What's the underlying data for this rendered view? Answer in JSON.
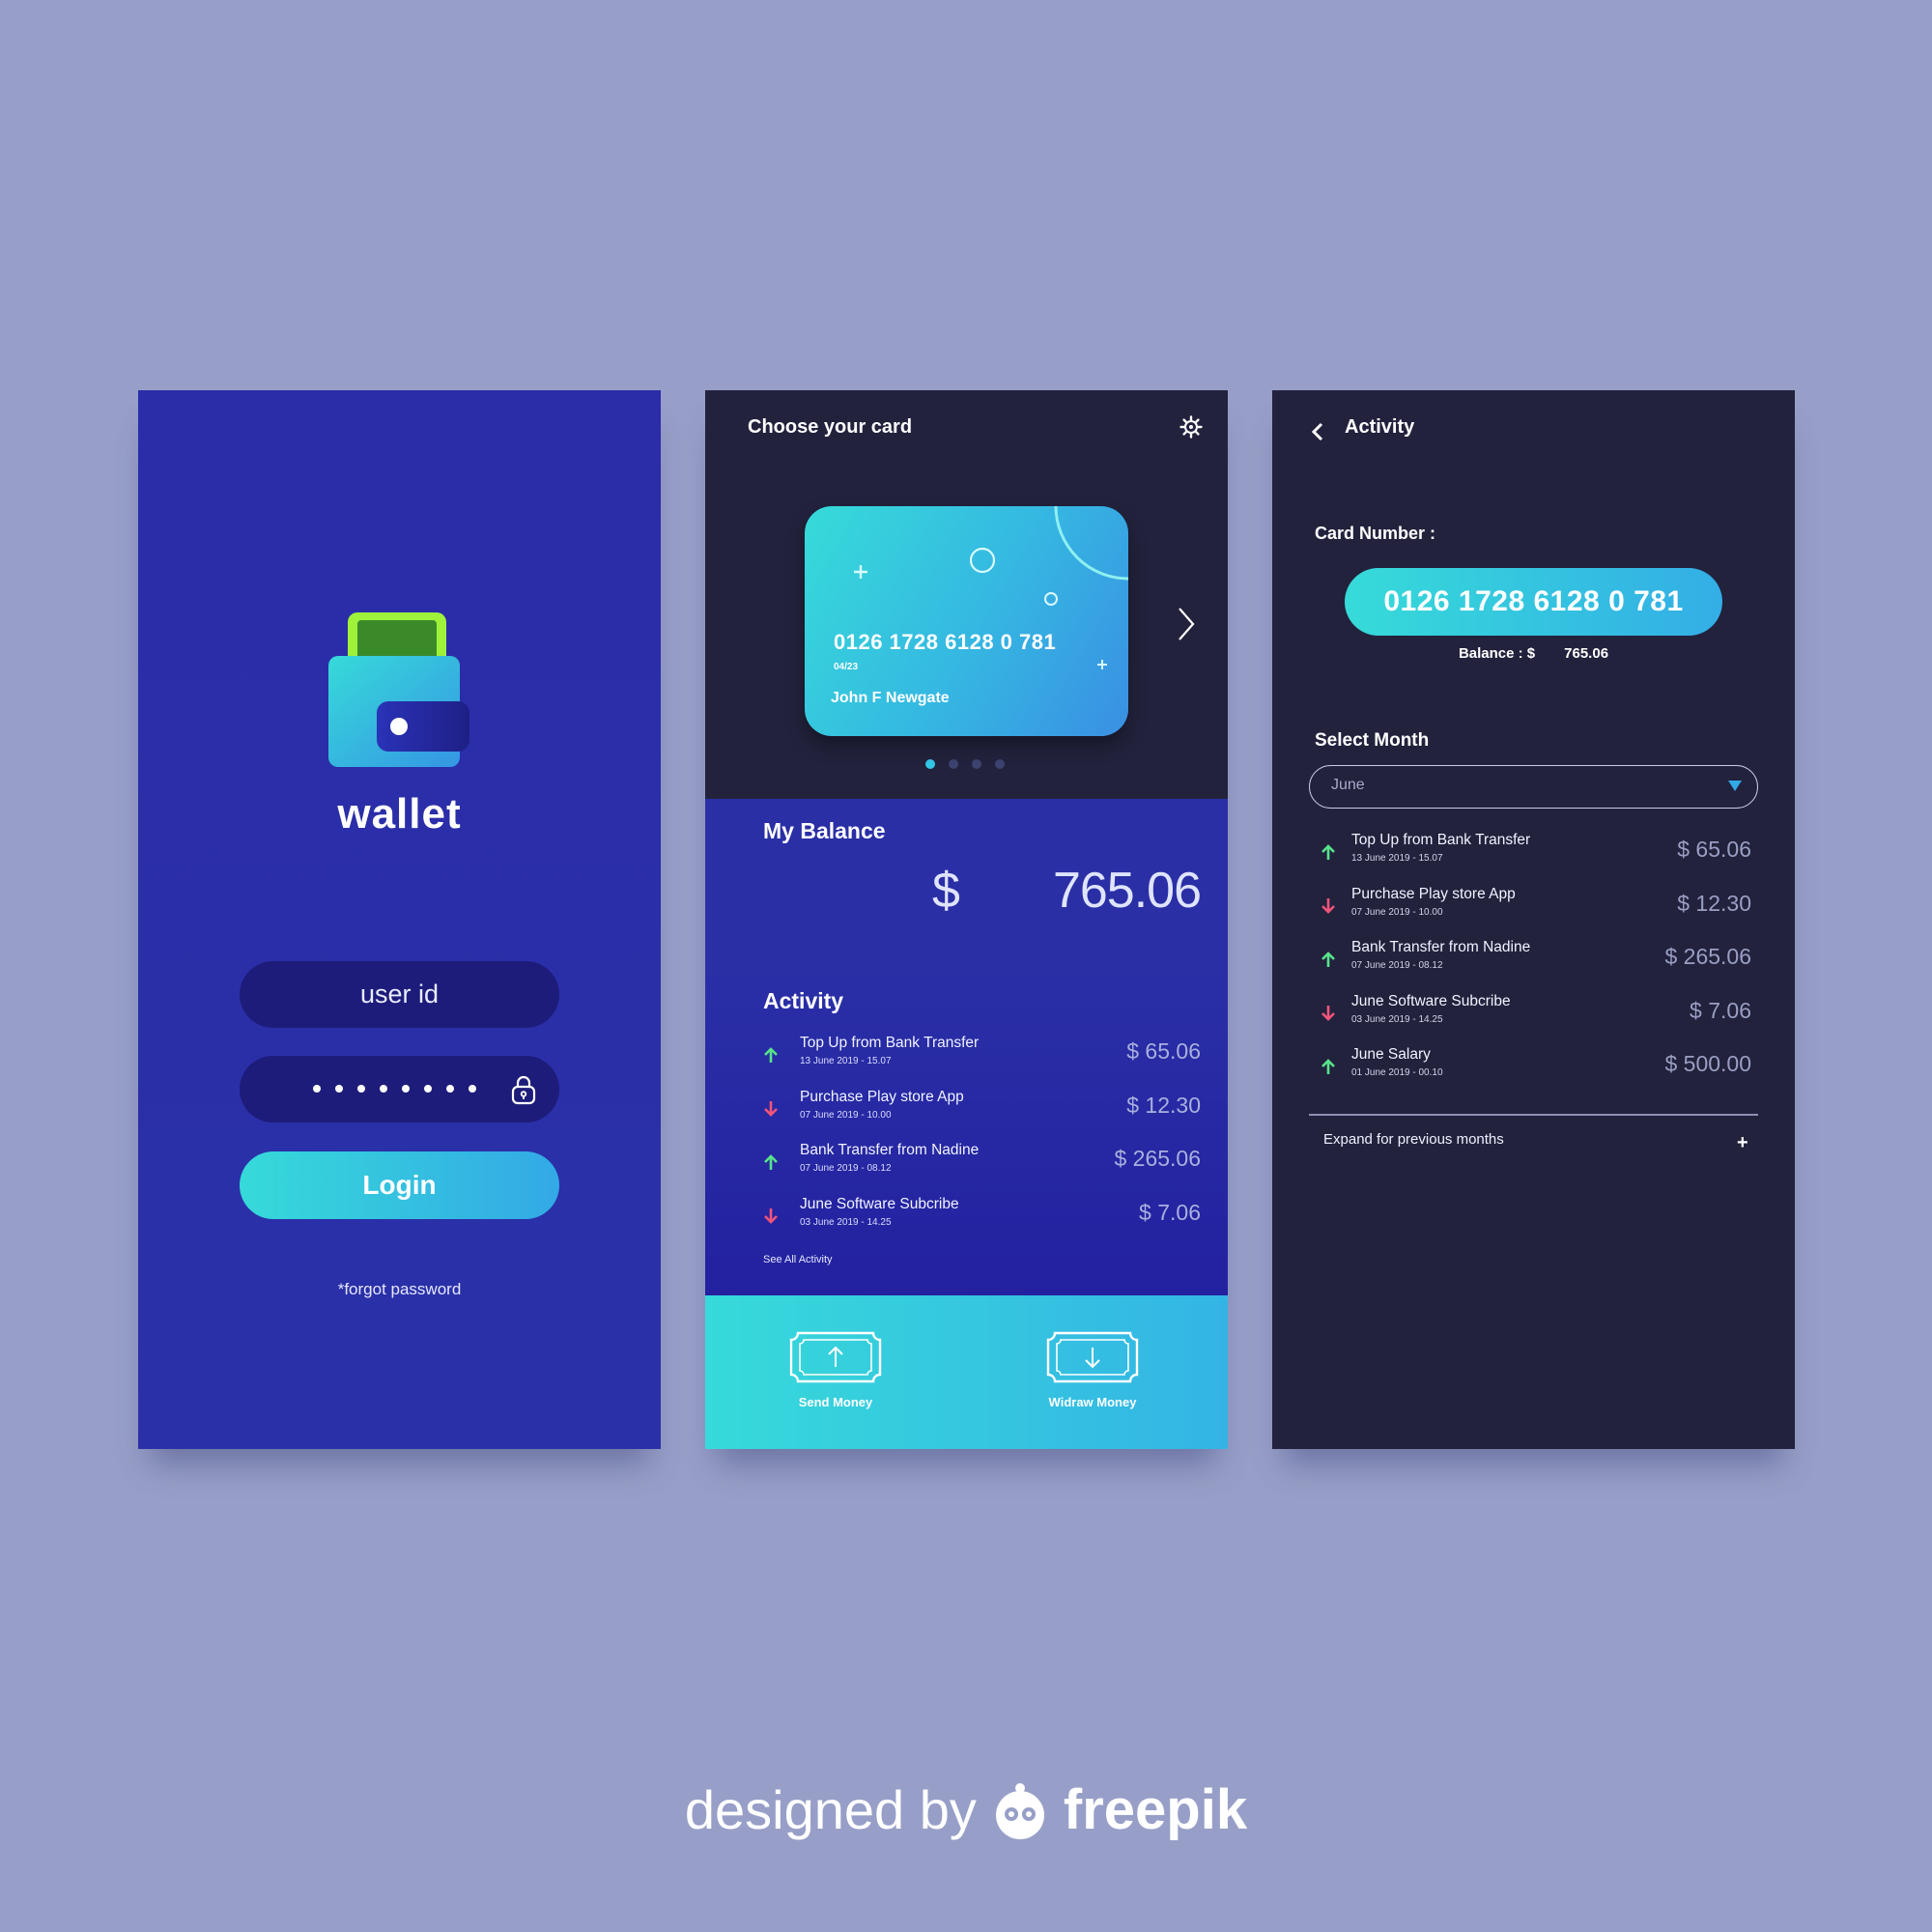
{
  "login": {
    "title": "wallet",
    "user_placeholder": "user id",
    "login_label": "Login",
    "forgot_label": "*forgot password"
  },
  "cards": {
    "header": "Choose your card",
    "card": {
      "number": "0126 1728 6128 0 781",
      "expiry": "04/23",
      "holder": "John F Newgate"
    },
    "pager": {
      "count": 4,
      "active_index": 0
    },
    "balance": {
      "title": "My Balance",
      "currency": "$",
      "amount": "765.06"
    },
    "activity": {
      "title": "Activity",
      "items": [
        {
          "name": "Top Up from Bank Transfer",
          "date": "13 June 2019 - 15.07",
          "amount": "$ 65.06",
          "direction": "in"
        },
        {
          "name": "Purchase Play store App",
          "date": "07 June 2019 - 10.00",
          "amount": "$ 12.30",
          "direction": "out"
        },
        {
          "name": "Bank Transfer from Nadine",
          "date": "07 June 2019 - 08.12",
          "amount": "$ 265.06",
          "direction": "in"
        },
        {
          "name": "June Software Subcribe",
          "date": "03 June 2019 - 14.25",
          "amount": "$ 7.06",
          "direction": "out"
        }
      ],
      "see_all": "See All Activity"
    },
    "actions": {
      "send": "Send Money",
      "withdraw": "Widraw Money"
    }
  },
  "activity_page": {
    "title": "Activity",
    "card_number_label": "Card Number :",
    "card_number": "0126 1728 6128 0 781",
    "balance_label": "Balance : $",
    "balance_value": "765.06",
    "select_month_label": "Select Month",
    "selected_month": "June",
    "items": [
      {
        "name": "Top Up from Bank Transfer",
        "date": "13 June 2019 - 15.07",
        "amount": "$ 65.06",
        "direction": "in"
      },
      {
        "name": "Purchase Play store App",
        "date": "07 June 2019 - 10.00",
        "amount": "$ 12.30",
        "direction": "out"
      },
      {
        "name": "Bank Transfer from Nadine",
        "date": "07 June 2019 - 08.12",
        "amount": "$ 265.06",
        "direction": "in"
      },
      {
        "name": "June Software Subcribe",
        "date": "03 June 2019 - 14.25",
        "amount": "$ 7.06",
        "direction": "out"
      },
      {
        "name": "June Salary",
        "date": "01 June 2019 - 00.10",
        "amount": "$ 500.00",
        "direction": "in"
      }
    ],
    "expand_label": "Expand for previous months",
    "expand_symbol": "+"
  },
  "credit": {
    "prefix": "designed by",
    "brand": "freepik"
  },
  "colors": {
    "background": "#979fc8",
    "login_bg": "#2b2ca8",
    "dark_bg": "#22223d",
    "accent_cyan": "#36dad9",
    "accent_blue": "#33a9e6",
    "arrow_in": "#58e38a",
    "arrow_out": "#f2547a"
  }
}
